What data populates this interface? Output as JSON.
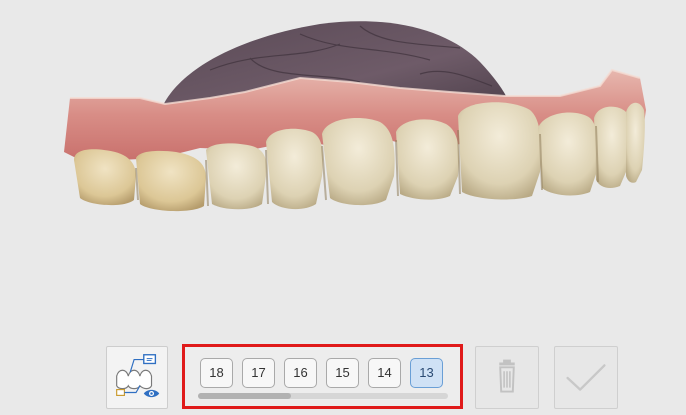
{
  "toolbar": {
    "view_toggle_icon": "teeth-view-eye-icon",
    "tooth_numbers": [
      "18",
      "17",
      "16",
      "15",
      "14",
      "13"
    ],
    "selected_tooth": "13",
    "scroll_fraction_visible": 0.37,
    "delete_icon": "trash-icon",
    "confirm_icon": "check-icon"
  },
  "colors": {
    "background": "#e9e9e9",
    "highlight_border": "#e01a1a",
    "selected_chip": "#cfe1f5",
    "accent_blue": "#2f6fc2"
  }
}
